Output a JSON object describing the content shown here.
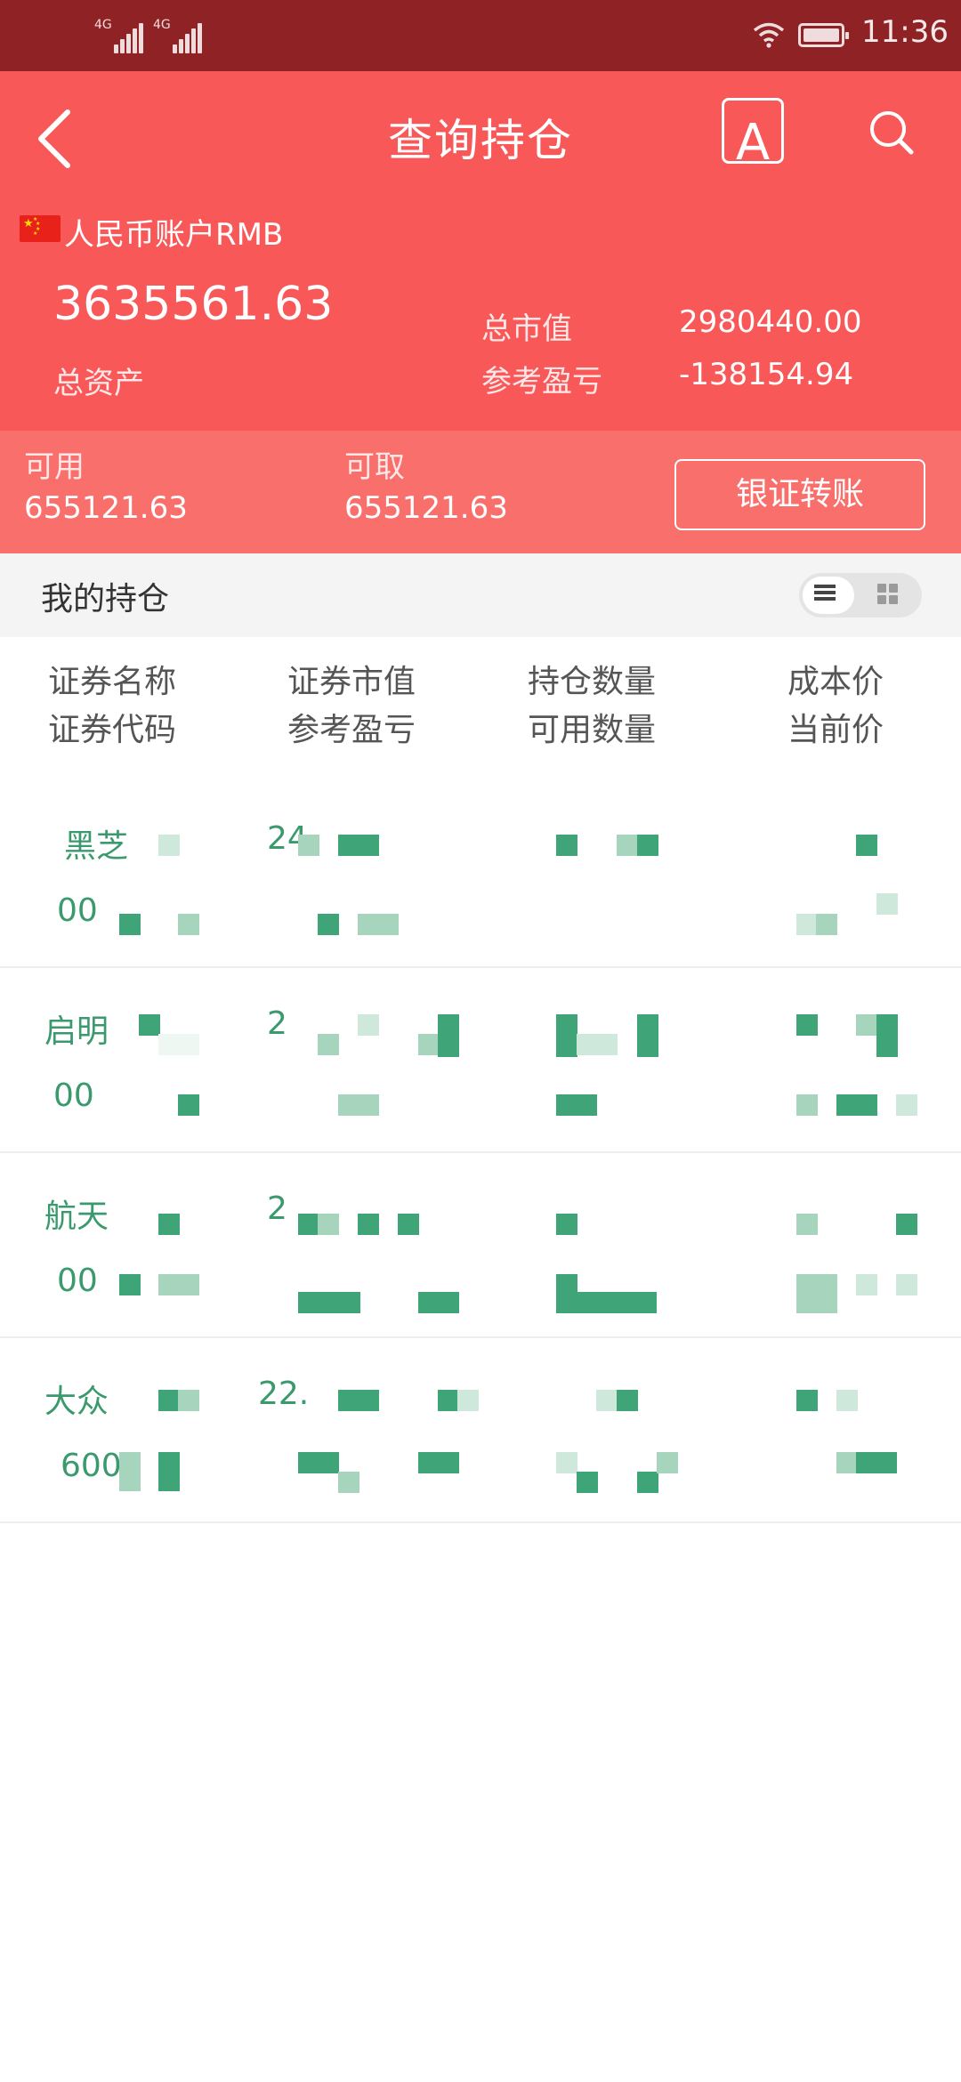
{
  "status_bar": {
    "signal_1_label": "4G",
    "signal_2_label": "4G",
    "time": "11:36"
  },
  "header": {
    "title": "查询持仓",
    "font_button_label": "A"
  },
  "account": {
    "name": "人民币账户RMB",
    "total_assets_value": "3635561.63",
    "total_assets_label": "总资产",
    "market_value_label": "总市值",
    "market_value": "2980440.00",
    "profit_loss_label": "参考盈亏",
    "profit_loss": "-138154.94"
  },
  "available": {
    "usable_label": "可用",
    "usable_value": "655121.63",
    "withdrawable_label": "可取",
    "withdrawable_value": "655121.63",
    "transfer_button": "银证转账"
  },
  "holdings": {
    "section_title": "我的持仓",
    "columns": [
      {
        "top": "证券名称",
        "bottom": "证券代码"
      },
      {
        "top": "证券市值",
        "bottom": "参考盈亏"
      },
      {
        "top": "持仓数量",
        "bottom": "可用数量"
      },
      {
        "top": "成本价",
        "bottom": "当前价"
      }
    ],
    "rows": [
      {
        "name": "黑芝",
        "code": "00",
        "market_value": "24"
      },
      {
        "name": "启明",
        "code": "00",
        "market_value": "2"
      },
      {
        "name": "航天",
        "code": "00",
        "market_value": "2"
      },
      {
        "name": "大众",
        "code": "600",
        "market_value": "22."
      }
    ]
  },
  "colors": {
    "status_bar": "#8e2224",
    "header": "#f85858",
    "band": "#f96f6c",
    "holding_text": "#3a9a6d"
  },
  "icons": [
    "back-arrow-icon",
    "font-size-icon",
    "search-icon",
    "china-flag-icon",
    "list-view-icon",
    "grid-view-icon",
    "wifi-icon",
    "battery-icon",
    "signal-icon"
  ]
}
